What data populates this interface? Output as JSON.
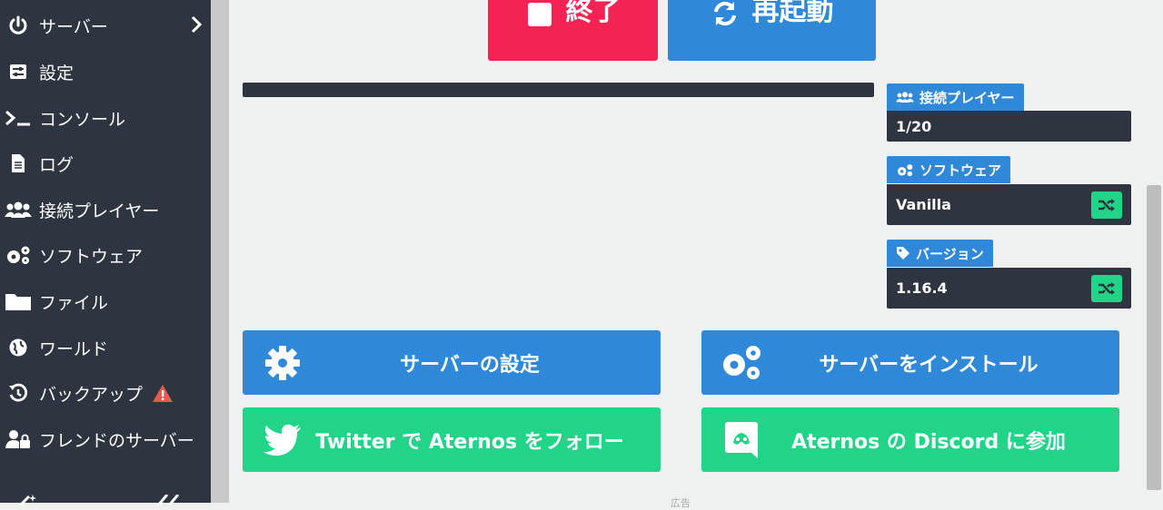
{
  "sidebar": {
    "items": [
      {
        "label": "サーバー",
        "icon": "power-icon"
      },
      {
        "label": "設定",
        "icon": "sliders-icon"
      },
      {
        "label": "コンソール",
        "icon": "terminal-icon"
      },
      {
        "label": "ログ",
        "icon": "file-icon"
      },
      {
        "label": "接続プレイヤー",
        "icon": "users-icon"
      },
      {
        "label": "ソフトウェア",
        "icon": "gears-icon"
      },
      {
        "label": "ファイル",
        "icon": "folder-icon"
      },
      {
        "label": "ワールド",
        "icon": "globe-icon"
      },
      {
        "label": "バックアップ",
        "icon": "history-icon"
      },
      {
        "label": "フレンドのサーバー",
        "icon": "user-lock-icon"
      }
    ]
  },
  "controls": {
    "stop_label": "終了",
    "restart_label": "再起動"
  },
  "info": {
    "players_title": "接続プレイヤー",
    "players_value": "1/20",
    "software_title": "ソフトウェア",
    "software_value": "Vanilla",
    "version_title": "バージョン",
    "version_value": "1.16.4"
  },
  "actions": {
    "server_settings": "サーバーの設定",
    "install_server": "サーバーをインストール",
    "twitter_follow": "Twitter で Aternos をフォロー",
    "discord_join": "Aternos の Discord に参加"
  },
  "ad_label": "広告",
  "colors": {
    "sidebar_bg": "#2e3540",
    "stop_red": "#f52353",
    "primary_blue": "#2f89d8",
    "success_green": "#21d488",
    "warning_red": "#e85a4f"
  }
}
